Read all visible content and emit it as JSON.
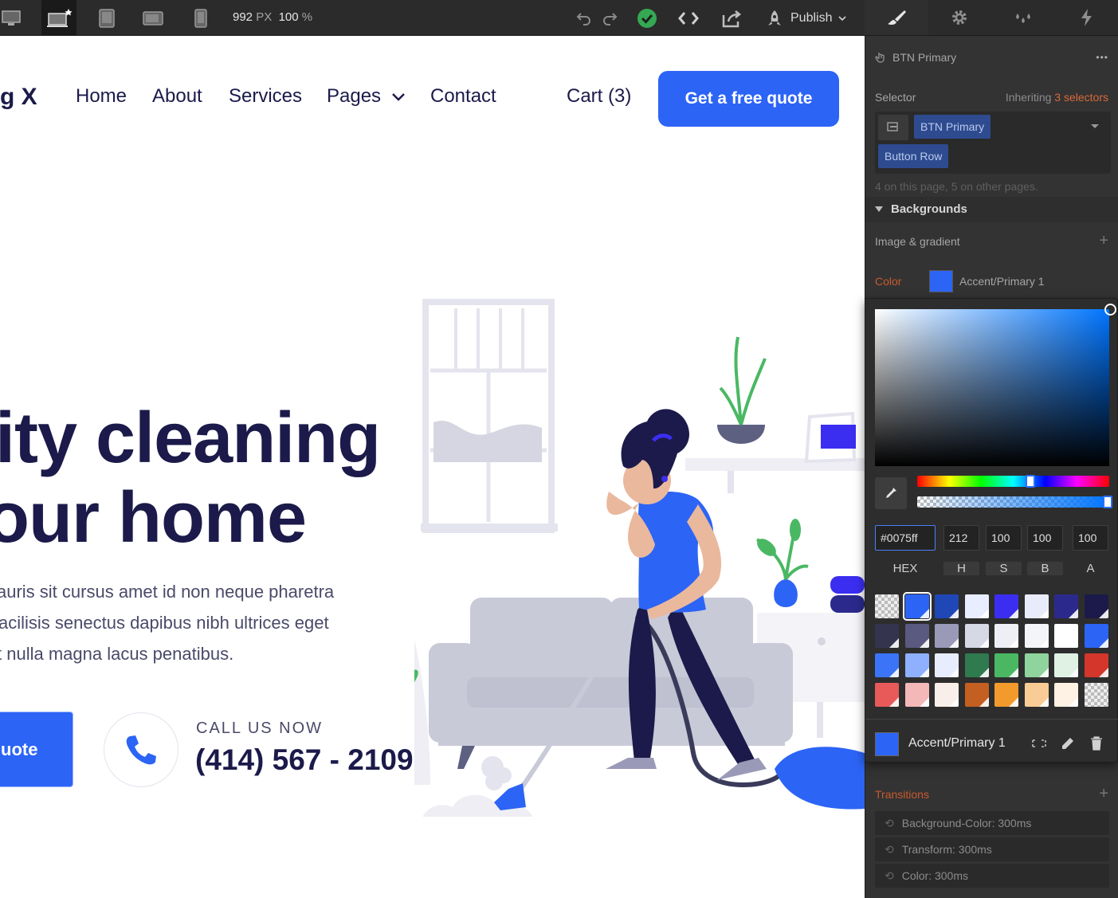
{
  "toolbar": {
    "width_value": "992",
    "width_unit": "PX",
    "zoom_value": "100",
    "zoom_unit": "%",
    "publish_label": "Publish"
  },
  "site": {
    "logo_text": "g X",
    "nav": [
      "Home",
      "About",
      "Services",
      "Pages",
      "Contact"
    ],
    "cart_label": "Cart (3)",
    "quote_button": "Get a free quote",
    "hero_line1": "lity cleaning",
    "hero_line2": "our home",
    "hero_sub": [
      "auris sit cursus amet id non neque pharetra",
      "acilisis senectus dapibus nibh ultrices eget",
      "t nulla magna lacus penatibus."
    ],
    "hero_button": "uote",
    "call_label": "CALL US NOW",
    "call_number": "(414) 567 - 2109"
  },
  "panel": {
    "element_name": "BTN Primary",
    "more": "•••",
    "selector_label": "Selector",
    "inheriting_label": "Inheriting",
    "inheriting_count": "3 selectors",
    "selector_chips": [
      "BTN Primary",
      "Button Row"
    ],
    "usage_text": "4 on this page, 5 on other pages.",
    "backgrounds_label": "Backgrounds",
    "image_gradient_label": "Image & gradient",
    "color_label": "Color",
    "color_value": "Accent/Primary 1",
    "transitions_label": "Transitions",
    "transitions": [
      "Background-Color: 300ms",
      "Transform: 300ms",
      "Color: 300ms"
    ]
  },
  "picker": {
    "hex_value": "#0075ff",
    "h_value": "212",
    "s_value": "100",
    "b_value": "100",
    "a_value": "100",
    "labels": [
      "HEX",
      "H",
      "S",
      "B",
      "A"
    ],
    "swatch_name": "Accent/Primary 1",
    "hue_fraction": 0.59,
    "alpha_fraction": 1.0,
    "swatches": [
      "transparent",
      "#2c64f6",
      "#1f47b5",
      "#e8eeff",
      "#3b2ef0",
      "#e8ecfa",
      "#2b2a8c",
      "#1b1a4a",
      "#35344f",
      "#5a5a80",
      "#9a9ab8",
      "#d6d8e6",
      "#eeeff4",
      "#f4f5f8",
      "#ffffff",
      "#2c64f6",
      "#3b74f7",
      "#8fb0ff",
      "#e8edfd",
      "#2f7a4f",
      "#4ab863",
      "#8fd49c",
      "#dff2e4",
      "#d4362c",
      "#e85a5a",
      "#f4b8b8",
      "#f8eeea",
      "#c45f22",
      "#f39a2d",
      "#f8cc94",
      "#fdf2e3",
      "transparent"
    ]
  },
  "colors": {
    "accent": "#2c64f6",
    "heading": "#1b1a4a",
    "panel_bg": "#333333"
  },
  "icons": [
    "desktop-icon",
    "desktop-star-icon",
    "tablet-icon",
    "tablet-landscape-icon",
    "phone-icon",
    "undo-icon",
    "redo-icon",
    "check-circle-icon",
    "code-icon",
    "export-icon",
    "publish-rocket-icon",
    "brush-icon",
    "gear-icon",
    "drops-icon",
    "lightning-icon",
    "eyedropper-icon",
    "detach-icon",
    "pencil-icon",
    "trash-icon"
  ]
}
